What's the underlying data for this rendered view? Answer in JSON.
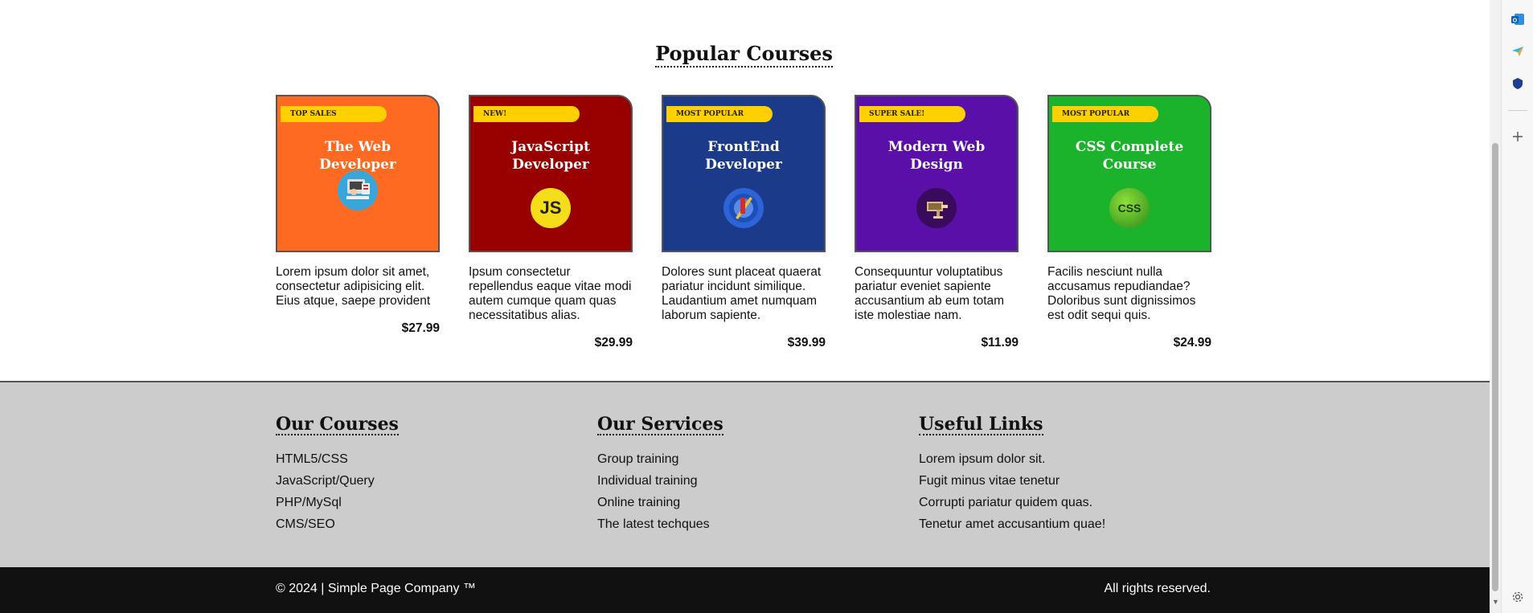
{
  "main": {
    "section_title": "Popular Courses",
    "courses": [
      {
        "badge": "TOP SALES",
        "title": "The Web Developer",
        "description": "Lorem ipsum dolor sit amet, consectetur adipisicing elit. Eius atque, saepe provident",
        "price": "$27.99",
        "color": "#ff6a22",
        "icon": "developer-desk-icon"
      },
      {
        "badge": "NEW!",
        "title": "JavaScript Developer",
        "description": "Ipsum consectetur repellendus eaque vitae modi autem cumque quam quas necessitatibus alias.",
        "price": "$29.99",
        "color": "#980000",
        "icon": "js-logo-icon",
        "icon_text": "JS"
      },
      {
        "badge": "MOST POPULAR",
        "title": "FrontEnd Developer",
        "description": "Dolores sunt placeat quaerat pariatur incidunt similique. Laudantium amet numquam laborum sapiente.",
        "price": "$39.99",
        "color": "#1c3a8a",
        "icon": "frontend-compass-icon"
      },
      {
        "badge": "SUPER SALE!",
        "title": "Modern Web Design",
        "description": "Consequuntur voluptatibus pariatur eveniet sapiente accusantium ab eum totam iste molestiae nam.",
        "price": "$11.99",
        "color": "#5a0fa8",
        "icon": "design-tools-icon"
      },
      {
        "badge": "MOST POPULAR",
        "title": "CSS Complete Course",
        "description": "Facilis nesciunt nulla accusamus repudiandae? Doloribus sunt dignissimos est odit sequi quis.",
        "price": "$24.99",
        "color": "#1cb32c",
        "icon": "css-logo-icon",
        "icon_text": "CSS"
      }
    ]
  },
  "footer": {
    "courses": {
      "heading": "Our Courses",
      "links": [
        "HTML5/CSS",
        "JavaScript/Query",
        "PHP/MySql",
        "CMS/SEO"
      ]
    },
    "services": {
      "heading": "Our Services",
      "links": [
        "Group training",
        "Individual training",
        "Online training",
        "The latest techques"
      ]
    },
    "useful": {
      "heading": "Useful Links",
      "links": [
        "Lorem ipsum dolor sit.",
        "Fugit minus vitae tenetur",
        "Corrupti pariatur quidem quas.",
        "Tenetur amet accusantium quae!"
      ]
    }
  },
  "bottom_bar": {
    "copyright": "© 2024 | Simple Page Company ™",
    "rights": "All rights reserved."
  },
  "side_rail": {
    "icons": [
      "outlook-icon",
      "send-icon",
      "shield-icon",
      "add-icon",
      "settings-icon"
    ]
  }
}
